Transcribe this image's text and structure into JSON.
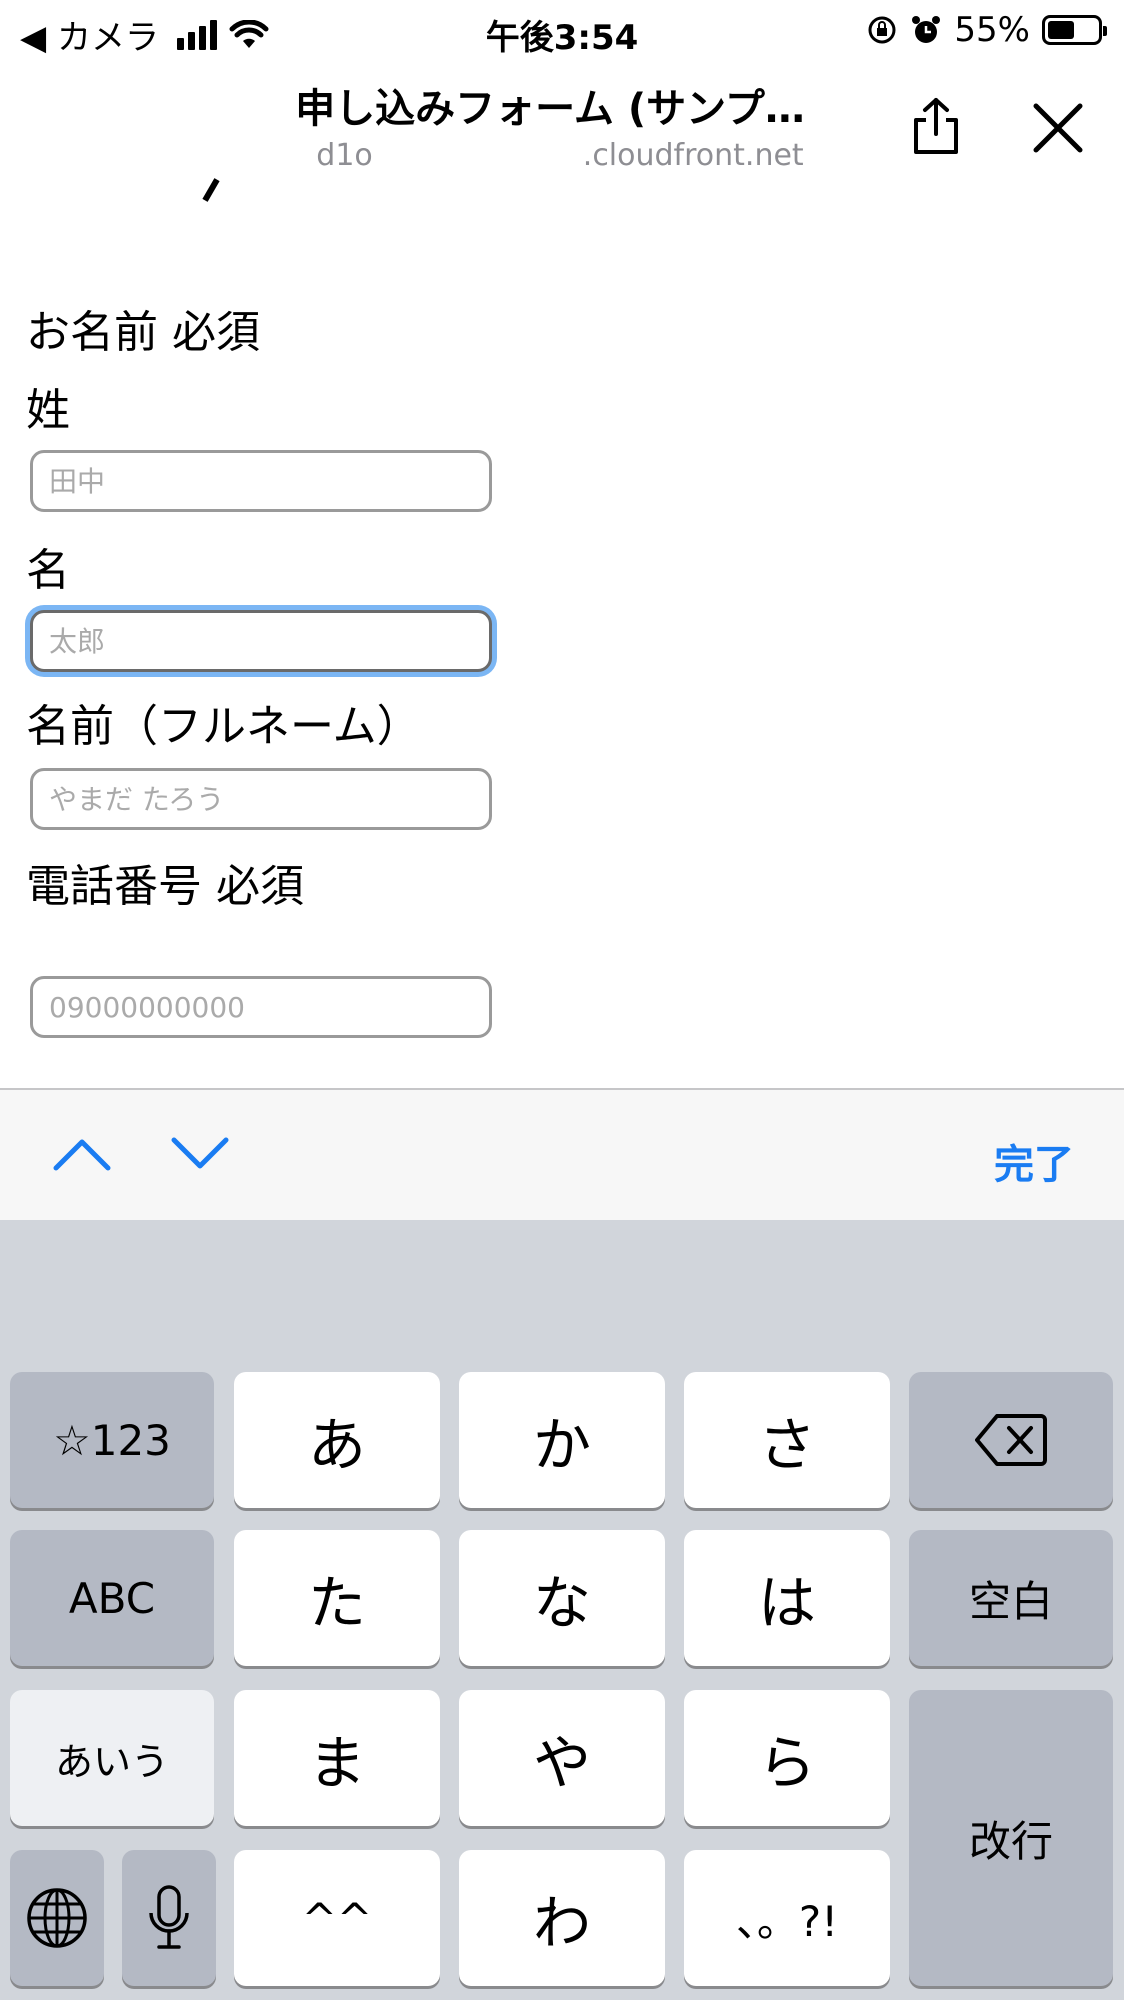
{
  "status_bar": {
    "back_label": "◀ カメラ",
    "time": "午後3:54",
    "battery_percent": "55%",
    "battery_level": 0.55
  },
  "nav": {
    "title": "申し込みフォーム (サンプ…",
    "url": "d1o       .cloudfront.net"
  },
  "form": {
    "name_heading": "お名前 必須",
    "last_name_label": "姓",
    "last_name_placeholder": "田中",
    "first_name_label": "名",
    "first_name_placeholder": "太郎",
    "full_name_label": "名前（フルネーム）",
    "full_name_placeholder": "やまだ たろう",
    "phone_label": "電話番号 必須",
    "phone_placeholder": "09000000000"
  },
  "accessory": {
    "done_label": "完了"
  },
  "keyboard": {
    "row1": [
      "☆123",
      "あ",
      "か",
      "さ"
    ],
    "row2": [
      "ABC",
      "た",
      "な",
      "は",
      "空白"
    ],
    "row3": [
      "あいう",
      "ま",
      "や",
      "ら",
      "改行"
    ],
    "row4": [
      "^^",
      "わ",
      "、。?!"
    ]
  },
  "colors": {
    "accent": "#1a7cf2",
    "focus_ring": "#7bb6f4",
    "keyboard_bg": "#d1d5db",
    "dark_key": "#b4b9c4"
  }
}
